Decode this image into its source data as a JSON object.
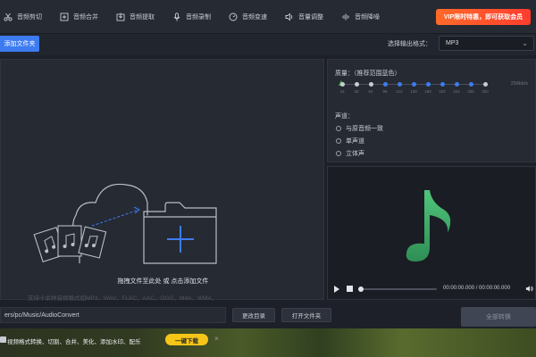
{
  "toolbar": {
    "items": [
      {
        "label": "音频剪切",
        "icon": "scissors-icon"
      },
      {
        "label": "音频合并",
        "icon": "merge-icon"
      },
      {
        "label": "音频提取",
        "icon": "extract-icon"
      },
      {
        "label": "音频录制",
        "icon": "microphone-icon"
      },
      {
        "label": "音频变速",
        "icon": "speed-icon"
      },
      {
        "label": "音量调整",
        "icon": "volume-icon"
      },
      {
        "label": "音频降噪",
        "icon": "noise-icon"
      }
    ],
    "vip_label": "VIP限时特惠，即可获取会员"
  },
  "subbar": {
    "add_folder_label": "添加文件夹",
    "format_label": "选择输出格式：",
    "format_value": "MP3"
  },
  "dropzone": {
    "title": "拖拽文件至此处 或 点击添加文件",
    "description": "支持十余种音频格式如MP3、WAV、FLAC、AAC、OGG、M4A、WMA、AC3、AMR、APE格式转换，同时提供、压缩音频质量"
  },
  "quality": {
    "label": "质量：（推荐范围蓝色）",
    "ticks": [
      "16",
      "32",
      "64",
      "96",
      "112",
      "128",
      "160",
      "192",
      "224",
      "256",
      "320"
    ],
    "current_label": "256kb/s"
  },
  "channel": {
    "label": "声道：",
    "options": [
      "与原音频一致",
      "单声道",
      "立体声"
    ]
  },
  "preview": {
    "timecode": "00:00:00.000 / 00:00:00.000"
  },
  "bottom": {
    "path": "ers/pc/Music/AudioConvert",
    "change_dir_label": "更改目录",
    "open_folder_label": "打开文件夹",
    "convert_label": "全部转换"
  },
  "ad": {
    "text": "视频格式转换、切割、合并、美化、添加水印、配乐",
    "button_label": "一键下载",
    "close_label": "×"
  },
  "colors": {
    "accent": "#3d7cf0",
    "vip": "#ff4d2e",
    "note_green": "#4fc47a"
  }
}
